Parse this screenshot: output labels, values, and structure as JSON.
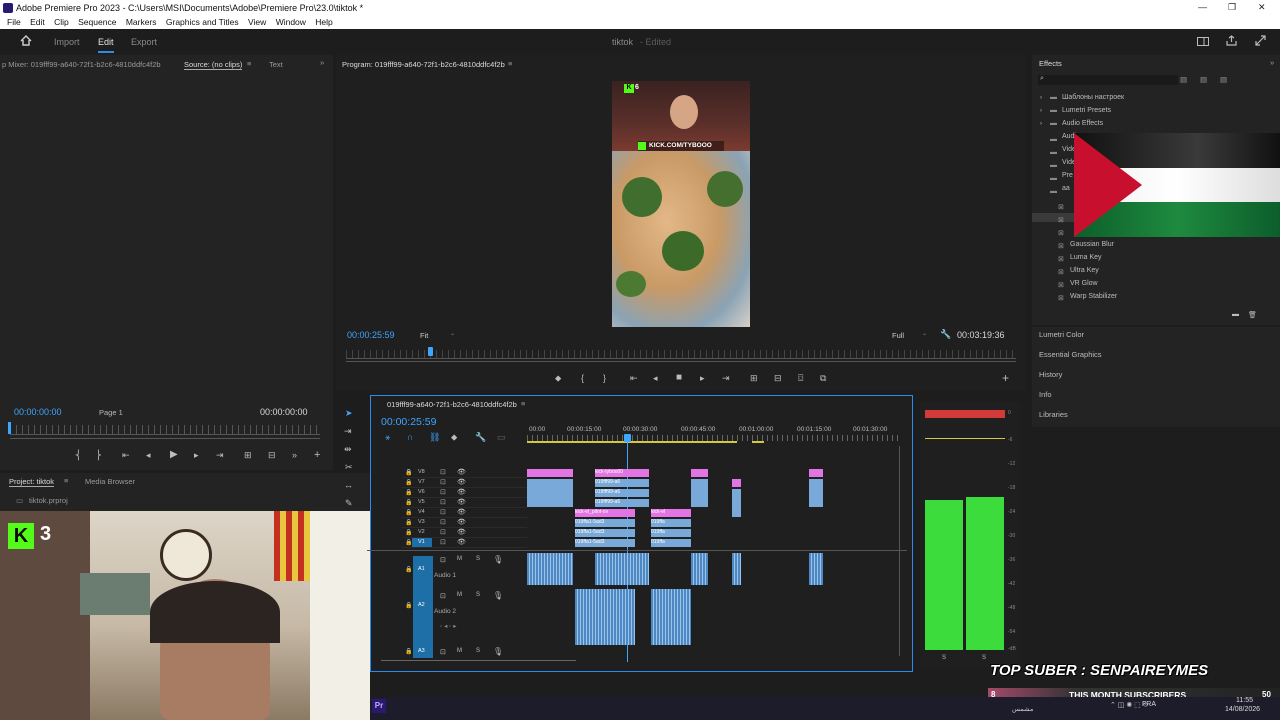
{
  "titlebar": {
    "title": "Adobe Premiere Pro 2023 - C:\\Users\\MSI\\Documents\\Adobe\\Premiere Pro\\23.0\\tiktok *",
    "minimize": "—",
    "maximize": "❐",
    "close": "✕"
  },
  "menu": [
    "File",
    "Edit",
    "Clip",
    "Sequence",
    "Markers",
    "Graphics and Titles",
    "View",
    "Window",
    "Help"
  ],
  "workspace": {
    "tabs": [
      "Import",
      "Edit",
      "Export"
    ],
    "active": "Edit",
    "project_name": "tiktok",
    "status": "- Edited"
  },
  "source_panel": {
    "mixer_tab": "p Mixer: 019fff99-a640-72f1-b2c6-4810ddfc4f2b",
    "source_tab": "Source: (no clips)",
    "text_tab": "Text",
    "timecode_left": "00:00:00:00",
    "page": "Page 1",
    "timecode_right": "00:00:00:00"
  },
  "program_panel": {
    "title": "Program: 019fff99-a640-72f1-b2c6-4810ddfc4f2b",
    "timecode": "00:00:25:59",
    "fit": "Fit",
    "quality": "Full",
    "duration": "00:03:19:36",
    "overlay_text": "KICK.COM/TYBOOO",
    "badge": "6"
  },
  "project_panel": {
    "tab_project": "Project: tiktok",
    "tab_media": "Media Browser",
    "file": "tiktok.prproj"
  },
  "timeline": {
    "title": "019fff99-a640-72f1-b2c6-4810ddfc4f2b",
    "timecode": "00:00:25:59",
    "ruler": [
      "00:00",
      "00:00:15:00",
      "00:00:30:00",
      "00:00:45:00",
      "00:01:00:00",
      "00:01:15:00",
      "00:01:30:00"
    ],
    "video_tracks": [
      "V8",
      "V7",
      "V6",
      "V5",
      "V4",
      "V3",
      "V2",
      "V1"
    ],
    "audio_tracks": [
      {
        "id": "A1",
        "name": "Audio 1"
      },
      {
        "id": "A2",
        "name": "Audio 2"
      },
      {
        "id": "A3",
        "name": ""
      }
    ],
    "clip_labels": {
      "v8": "kick-tyboo00",
      "v7": "019fff99-a6",
      "v6": "019fff99-a6",
      "v5": "019fff99-a6",
      "v4a": "kick-el_pilot-ov",
      "v4b": "kick-el",
      "v3a": "019ffa1-5ad3",
      "v3b": "019ffa",
      "v2a": "019ffa1-5ad3",
      "v2b": "019ffa",
      "v1a": "019ffa1-5ad3",
      "v1b": "019ffa"
    }
  },
  "meter": {
    "scale": [
      "0",
      "-6",
      "-12",
      "-18",
      "-24",
      "-30",
      "-36",
      "-42",
      "-48",
      "-54",
      "-dB"
    ],
    "left_level": 0.82,
    "right_level": 0.84,
    "solo": [
      "S",
      "S"
    ]
  },
  "effects_panel": {
    "title": "Effects",
    "folders": [
      "Шаблоны настроек",
      "Lumetri Presets",
      "Audio Effects",
      "Audi",
      "Vide",
      "Vide",
      "Pre",
      "aa"
    ],
    "items": [
      "Gaussian Blur",
      "Luma Key",
      "Ultra Key",
      "VR Glow",
      "Warp Stabilizer"
    ],
    "sections": [
      "Lumetri Color",
      "Essential Graphics",
      "History",
      "Info",
      "Libraries"
    ]
  },
  "overlays": {
    "webcam_badge": "3",
    "subs_line": "TOP SUBER : SENPAIREYMES",
    "subs_bar": "THIS MONTH SUBSCRIBERS",
    "subs_left": "8",
    "subs_right": "50"
  },
  "taskbar": {
    "app": "Pr",
    "search_hint": "مشمس",
    "lang": "FRA",
    "time": "11:55",
    "date": "14/08/2026"
  },
  "colors": {
    "accent": "#2d8ceb",
    "timecode": "#3ea6ff",
    "clip_pink": "#e374e3",
    "clip_blue": "#79a9d8",
    "meter_green": "#3ddc3d",
    "meter_red": "#d43a3a",
    "kick_green": "#53fc18"
  }
}
